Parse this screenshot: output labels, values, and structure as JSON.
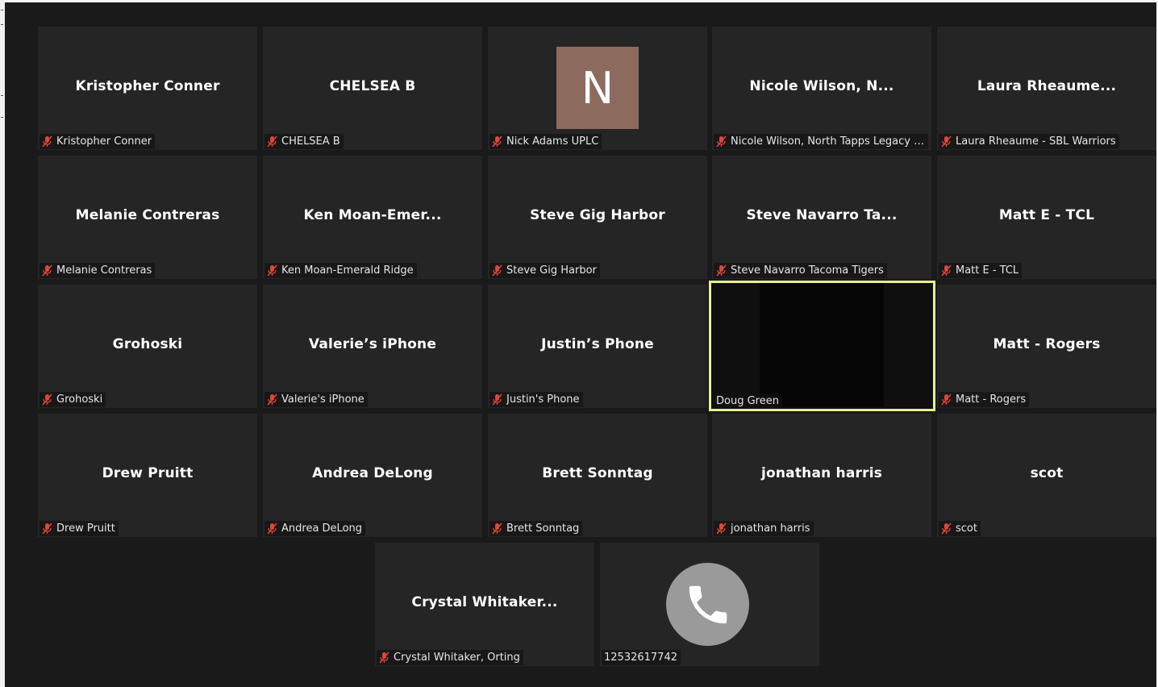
{
  "participants": [
    {
      "display": "Kristopher Conner",
      "caption": "Kristopher Conner",
      "muted": true
    },
    {
      "display": "CHELSEA B",
      "caption": "CHELSEA B",
      "muted": true
    },
    {
      "display": "N",
      "caption": "Nick Adams UPLC",
      "muted": true,
      "avatar_color": "#8c6b5e"
    },
    {
      "display": "Nicole  Wilson,  N...",
      "caption": "Nicole Wilson, North Tapps Legacy La...",
      "muted": true
    },
    {
      "display": "Laura  Rheaume...",
      "caption": "Laura Rheaume - SBL Warriors",
      "muted": true
    },
    {
      "display": "Melanie Contreras",
      "caption": "Melanie Contreras",
      "muted": true
    },
    {
      "display": "Ken  Moan-Emer...",
      "caption": "Ken Moan-Emerald Ridge",
      "muted": true
    },
    {
      "display": "Steve Gig Harbor",
      "caption": "Steve Gig Harbor",
      "muted": true
    },
    {
      "display": "Steve  Navarro  Ta...",
      "caption": "Steve Navarro Tacoma Tigers",
      "muted": true
    },
    {
      "display": "Matt E - TCL",
      "caption": "Matt E - TCL",
      "muted": true
    },
    {
      "display": "Grohoski",
      "caption": "Grohoski",
      "muted": true
    },
    {
      "display": "Valerie’s iPhone",
      "caption": "Valerie's iPhone",
      "muted": true
    },
    {
      "display": "Justin’s Phone",
      "caption": "Justin's Phone",
      "muted": true
    },
    {
      "display": "",
      "caption": "Doug Green",
      "muted": false,
      "active_speaker": true
    },
    {
      "display": "Matt  -  Rogers",
      "caption": "Matt - Rogers",
      "muted": true
    },
    {
      "display": "Drew Pruitt",
      "caption": "Drew Pruitt",
      "muted": true
    },
    {
      "display": "Andrea DeLong",
      "caption": "Andrea DeLong",
      "muted": true
    },
    {
      "display": "Brett Sonntag",
      "caption": "Brett Sonntag",
      "muted": true
    },
    {
      "display": "jonathan harris",
      "caption": "jonathan harris",
      "muted": true
    },
    {
      "display": "scot",
      "caption": "scot",
      "muted": true
    },
    {
      "display": "Crystal Whitaker...",
      "caption": "Crystal Whitaker, Orting",
      "muted": true
    },
    {
      "display": "",
      "caption": "12532617742",
      "muted": false,
      "phone": true
    }
  ],
  "colors": {
    "tile_bg": "#252525",
    "active_border": "#e6f28c",
    "muted_icon": "#e0453a"
  },
  "icons": {
    "muted": "microphone-muted-icon",
    "phone": "phone-icon"
  }
}
